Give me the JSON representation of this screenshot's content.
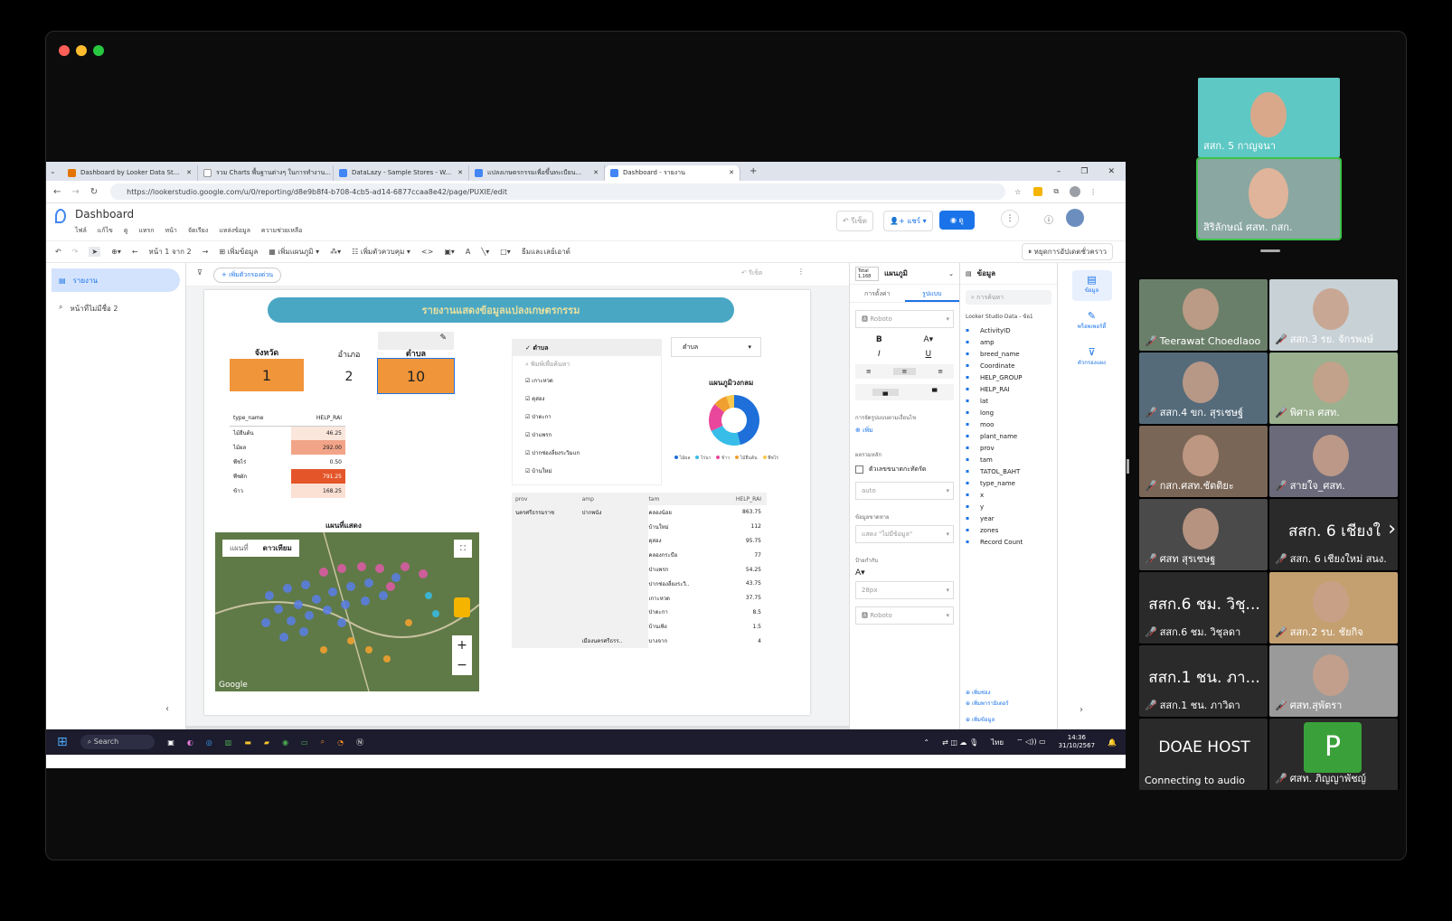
{
  "browser": {
    "tabs": [
      {
        "label": "Dashboard by Looker Data St..."
      },
      {
        "label": "รวม Charts พื้นฐานต่างๆ ในการทำงาน..."
      },
      {
        "label": "DataLazy - Sample Stores - W..."
      },
      {
        "label": "แปลงเกษตรกรรมเพื่อขึ้นทะเบียน..."
      },
      {
        "label": "Dashboard - รายงาน"
      }
    ],
    "url": "https://lookerstudio.google.com/u/0/reporting/d8e9b8f4-b708-4cb5-ad14-6877ccaa8e42/page/PUXIE/edit"
  },
  "looker": {
    "title": "Dashboard",
    "menu": [
      "ไฟล์",
      "แก้ไข",
      "ดู",
      "แทรก",
      "หน้า",
      "จัดเรียง",
      "แหล่งข้อมูล",
      "ความช่วยเหลือ"
    ],
    "undo_label": "รีเซ็ต",
    "share_label": "แชร์",
    "view_label": "ดู",
    "toolbar": {
      "page": "หน้า 1 จาก 2",
      "add_data": "เพิ่มข้อมูล",
      "add_chart": "เพิ่มแผนภูมิ",
      "add_control": "เพิ่มตัวควบคุม",
      "theme": "ธีมและเลย์เอาต์",
      "pause": "หยุดการอัปเดตชั่วคราว"
    },
    "left_pages": [
      "รายงาน",
      "หน้าที่ไม่มีชื่อ 2"
    ],
    "filter_btn": "+ เพิ่มตัวกรองด่วน",
    "reset": "รีเซ็ต"
  },
  "report": {
    "title": "รายงานแสดงข้อมูลแปลงเกษตรกรรม",
    "kpi": [
      {
        "label": "จังหวัด",
        "value": "1"
      },
      {
        "label": "อำเภอ",
        "value": "2"
      },
      {
        "label": "ตำบล",
        "value": "10"
      }
    ],
    "type_table": {
      "headers": [
        "type_name",
        "HELP_RAI"
      ],
      "rows": [
        [
          "ไม้ยืนต้น",
          "46.25"
        ],
        [
          "ไม้ผล",
          "292.00"
        ],
        [
          "พืชไร่",
          "0.50"
        ],
        [
          "พืชผัก",
          "791.25"
        ],
        [
          "ข้าว",
          "168.25"
        ]
      ]
    },
    "map": {
      "title": "แผนที่แสดง",
      "tabs": [
        "แผนที่",
        "ดาวเทียม"
      ],
      "google": "Google"
    },
    "dropdown": {
      "header": "ตำบล",
      "search": "พิมพ์เพื่อค้นหา",
      "items": [
        "เกาะหวด",
        "ดุสอง",
        "ป่าตะกา",
        "ป่าแพรก",
        "ปากช่องลี่ยงระวิมแก",
        "บ้านใหม่"
      ]
    },
    "select": "ตำบล",
    "donut": {
      "title": "แผนภูมิวงกลม",
      "legend": [
        "ไม้ผล",
        "ไร่นา",
        "ข้าว",
        "ไม้ยืนต้น",
        "พืชไร่"
      ],
      "colors": [
        "#1e6fd9",
        "#38bde8",
        "#e8479b",
        "#f0a030",
        "#f7c84c"
      ],
      "values": [
        46,
        22,
        18,
        9,
        5
      ]
    },
    "data_table": {
      "headers": [
        "prov",
        "amp",
        "tam",
        "HELP_RAI"
      ],
      "rows": [
        [
          "นครศรีธรรมราช",
          "ปากพนัง",
          "คลองน้อย",
          "863.75"
        ],
        [
          "",
          "",
          "บ้านใหม่",
          "112"
        ],
        [
          "",
          "",
          "ดุสอง",
          "95.75"
        ],
        [
          "",
          "",
          "คลองกระบือ",
          "77"
        ],
        [
          "",
          "",
          "ป่าแพรก",
          "54.25"
        ],
        [
          "",
          "",
          "ปากช่องลี่ยงระวิ..",
          "43.75"
        ],
        [
          "",
          "",
          "เกาะหวด",
          "37.75"
        ],
        [
          "",
          "",
          "ป่าตะกา",
          "8.5"
        ],
        [
          "",
          "",
          "บ้านเพิง",
          "1.5"
        ],
        [
          "",
          "เมืองนครศรีธรร..",
          "บางจาก",
          "4"
        ]
      ]
    }
  },
  "properties": {
    "count": "Total 1,168",
    "title": "แผนภูมิ",
    "tabs": [
      "การตั้งค่า",
      "รูปแบบ"
    ],
    "font": "Roboto",
    "section1": "การจัดรูปแบบตามเงื่อนไข",
    "add": "เพิ่ม",
    "section2": "ผลรวมหลัก",
    "checkbox": "ตัวเลขขนาดกะทัดรัด",
    "auto": "auto",
    "section3": "ข้อมูลขาดหาย",
    "missing": "แสดง \"ไม่มีข้อมูล\"",
    "section4": "ป้ายกำกับ",
    "size": "28px",
    "font2": "Roboto"
  },
  "datapanel": {
    "title": "ข้อมูล",
    "search": "การค้นหา",
    "source": "Looker Studio Data - ข้อ1",
    "fields": [
      "ActivityID",
      "amp",
      "breed_name",
      "Coordinate",
      "HELP_GROUP",
      "HELP_RAI",
      "lat",
      "long",
      "moo",
      "plant_name",
      "prov",
      "tam",
      "TATOL_BAHT",
      "type_name",
      "x",
      "y",
      "year",
      "zones",
      "Record Count"
    ],
    "links": [
      "เพิ่มช่อง",
      "เพิ่มพารามิเตอร์",
      "เพิ่มข้อมูล"
    ]
  },
  "sidebar_icons": [
    "ข้อมูล",
    "พร็อพเพอร์ตี้",
    "ตัวกรองแผง"
  ],
  "taskbar": {
    "search": "Search",
    "time": "14:36",
    "date": "31/10/2567",
    "lang": "ไทย"
  },
  "meeting": {
    "top": [
      {
        "name": "สสก. 5 กาญจนา"
      },
      {
        "name": "สิริลักษณ์ ศสท. กสก."
      }
    ],
    "grid": [
      {
        "name": "Teerawat Choedlaoo"
      },
      {
        "name": "สสก.3 รย. จักรพงษ์"
      },
      {
        "name": "สสก.4 ขก. สุรเชษฐ์"
      },
      {
        "name": "พิศาล ศสท."
      },
      {
        "name": "กสก.ศสท.ชัตติยะ"
      },
      {
        "name": "สายใจ_ศสท."
      },
      {
        "name": "ศสท สุรเชษฐ"
      },
      {
        "name": "สสก. 6 เชียงใหม่ สนง.",
        "big": "สสก. 6 เชียงใ"
      },
      {
        "name": "สสก.6 ชม. วิชุลดา",
        "big": "สสก.6 ชม. วิชุ..."
      },
      {
        "name": "สสก.2 รบ. ชัยกิจ"
      },
      {
        "name": "สสก.1 ชน. ภาวิดา",
        "big": "สสก.1 ชน. ภา..."
      },
      {
        "name": "ศสท.สุพัตรา"
      },
      {
        "name": "Connecting to audio",
        "big": "DOAE HOST"
      },
      {
        "name": "ศสท. ภิญญาพัชญ์",
        "initial": "P"
      }
    ]
  }
}
